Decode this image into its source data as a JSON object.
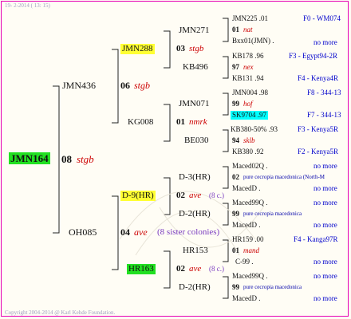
{
  "header": {
    "date": "19- 2-2014 ( 13: 15)"
  },
  "footer": {
    "copyright": "Copyright 2004-2014 @ Karl Kehde Foundation."
  },
  "colors": {
    "frame": "#e600b4",
    "green": "#22e022",
    "yellow": "#ffff33",
    "cyan": "#00ffff",
    "red": "#cc0000",
    "blue": "#0000cc"
  },
  "root": {
    "id": "JMN164",
    "gen": "08",
    "breed": "stgb"
  },
  "gen1": [
    {
      "id": "JMN436",
      "gen": "06",
      "breed": "stgb"
    },
    {
      "id": "OH085",
      "gen": "04",
      "breed": "ave",
      "sisters": "(8 sister colonies)"
    }
  ],
  "gen2": [
    {
      "id": "JMN288",
      "gen": "03",
      "breed": "stgb"
    },
    {
      "id": "KG008",
      "gen": "01",
      "breed": "nmrk"
    },
    {
      "id": "D-9(HR)",
      "gen": "02",
      "breed": "ave",
      "sisters": "(8 c.)"
    },
    {
      "id": "HR163",
      "gen": "02",
      "breed": "ave",
      "sisters": "(8 c.)"
    }
  ],
  "gen3": [
    {
      "id": "JMN271",
      "gen": "01",
      "breed": "nat"
    },
    {
      "id": "KB496",
      "gen": "97",
      "breed": "nex"
    },
    {
      "id": "JMN071",
      "gen": "99",
      "breed": "hof"
    },
    {
      "id": "BE030",
      "gen": "94",
      "breed": "sklb"
    },
    {
      "id": "D-3(HR)",
      "gen": "02",
      "breed": "pure cecropia macedonica (North-M"
    },
    {
      "id": "D-2(HR)",
      "gen": "99",
      "breed": "pure cecropia macedonica"
    },
    {
      "id": "HR153",
      "gen": "01",
      "breed": "mand"
    },
    {
      "id": "D-2(HR)",
      "gen": "99",
      "breed": "pure cecropia macedonica"
    }
  ],
  "gen4": [
    {
      "id": "JMN225 .01",
      "loc": "F0 - WM074"
    },
    {
      "id": "Bxx01(JMN) .",
      "loc": "no more"
    },
    {
      "id": "KB178 .96",
      "loc": "F3 - Egypt94-2R"
    },
    {
      "id": "KB131 .94",
      "loc": "F4 - Kenya4R"
    },
    {
      "id": "JMN004 .98",
      "loc": "F8 - 344-13"
    },
    {
      "id": "SK9704 .97",
      "loc": "F7 - 344-13"
    },
    {
      "id": "KB380-50% .93",
      "loc": "F3 - Kenya5R"
    },
    {
      "id": "KB380 .92",
      "loc": "F2 - Kenya5R"
    },
    {
      "id": "Maced02Q .",
      "loc": "no more"
    },
    {
      "id": "MacedD .",
      "loc": "no more"
    },
    {
      "id": "Maced99Q .",
      "loc": "no more"
    },
    {
      "id": "MacedD .",
      "loc": "no more"
    },
    {
      "id": "HR159 .00",
      "loc": "F4 - Kanga97R"
    },
    {
      "id": "C-99 .",
      "loc": "no more"
    },
    {
      "id": "Maced99Q .",
      "loc": "no more"
    },
    {
      "id": "MacedD .",
      "loc": "no more"
    }
  ]
}
